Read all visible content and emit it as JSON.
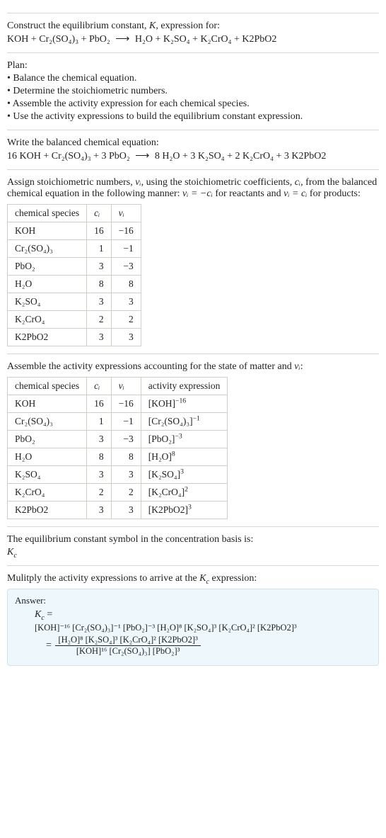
{
  "intro": {
    "line1_a": "Construct the equilibrium constant, ",
    "line1_b": ", expression for:",
    "eq_lhs": "KOH + Cr₂(SO₄)₃ + PbO₂",
    "arrow": "⟶",
    "eq_rhs": "H₂O + K₂SO₄ + K₂CrO₄ + K2PbO2"
  },
  "plan": {
    "heading": "Plan:",
    "b1": "• Balance the chemical equation.",
    "b2": "• Determine the stoichiometric numbers.",
    "b3": "• Assemble the activity expression for each chemical species.",
    "b4": "• Use the activity expressions to build the equilibrium constant expression."
  },
  "balanced": {
    "heading": "Write the balanced chemical equation:",
    "lhs": "16 KOH + Cr₂(SO₄)₃ + 3 PbO₂",
    "arrow": "⟶",
    "rhs": "8 H₂O + 3 K₂SO₄ + 2 K₂CrO₄ + 3 K2PbO2"
  },
  "stoich": {
    "text_a": "Assign stoichiometric numbers, ",
    "text_b": ", using the stoichiometric coefficients, ",
    "text_c": ", from the balanced chemical equation in the following manner: ",
    "text_d": " for reactants and ",
    "text_e": " for products:",
    "nu_i": "νᵢ",
    "c_i": "cᵢ",
    "rel1": "νᵢ = −cᵢ",
    "rel2": "νᵢ = cᵢ",
    "tbl": {
      "h1": "chemical species",
      "h2": "cᵢ",
      "h3": "νᵢ",
      "rows": [
        {
          "sp": "KOH",
          "c": "16",
          "n": "−16"
        },
        {
          "sp": "Cr₂(SO₄)₃",
          "c": "1",
          "n": "−1"
        },
        {
          "sp": "PbO₂",
          "c": "3",
          "n": "−3"
        },
        {
          "sp": "H₂O",
          "c": "8",
          "n": "8"
        },
        {
          "sp": "K₂SO₄",
          "c": "3",
          "n": "3"
        },
        {
          "sp": "K₂CrO₄",
          "c": "2",
          "n": "2"
        },
        {
          "sp": "K2PbO2",
          "c": "3",
          "n": "3"
        }
      ]
    }
  },
  "activity": {
    "heading_a": "Assemble the activity expressions accounting for the state of matter and ",
    "heading_b": ":",
    "nu_i": "νᵢ",
    "tbl": {
      "h1": "chemical species",
      "h2": "cᵢ",
      "h3": "νᵢ",
      "h4": "activity expression",
      "rows": [
        {
          "sp": "KOH",
          "c": "16",
          "n": "−16",
          "base": "[KOH]",
          "exp": "−16"
        },
        {
          "sp": "Cr₂(SO₄)₃",
          "c": "1",
          "n": "−1",
          "base": "[Cr₂(SO₄)₃]",
          "exp": "−1"
        },
        {
          "sp": "PbO₂",
          "c": "3",
          "n": "−3",
          "base": "[PbO₂]",
          "exp": "−3"
        },
        {
          "sp": "H₂O",
          "c": "8",
          "n": "8",
          "base": "[H₂O]",
          "exp": "8"
        },
        {
          "sp": "K₂SO₄",
          "c": "3",
          "n": "3",
          "base": "[K₂SO₄]",
          "exp": "3"
        },
        {
          "sp": "K₂CrO₄",
          "c": "2",
          "n": "2",
          "base": "[K₂CrO₄]",
          "exp": "2"
        },
        {
          "sp": "K2PbO2",
          "c": "3",
          "n": "3",
          "base": "[K2PbO2]",
          "exp": "3"
        }
      ]
    }
  },
  "symbol": {
    "text": "The equilibrium constant symbol in the concentration basis is:",
    "Kc": "K",
    "Kc_sub": "c"
  },
  "final": {
    "heading_a": "Mulitply the activity expressions to arrive at the ",
    "heading_b": " expression:",
    "Kc": "K",
    "Kc_sub": "c",
    "answer_label": "Answer:",
    "eq_sign": " =",
    "line2": "[KOH]⁻¹⁶ [Cr₂(SO₄)₃]⁻¹ [PbO₂]⁻³ [H₂O]⁸ [K₂SO₄]³ [K₂CrO₄]² [K2PbO2]³",
    "frac_num": "[H₂O]⁸ [K₂SO₄]³ [K₂CrO₄]² [K2PbO2]³",
    "frac_den": "[KOH]¹⁶ [Cr₂(SO₄)₃] [PbO₂]³",
    "eq2": "= "
  }
}
